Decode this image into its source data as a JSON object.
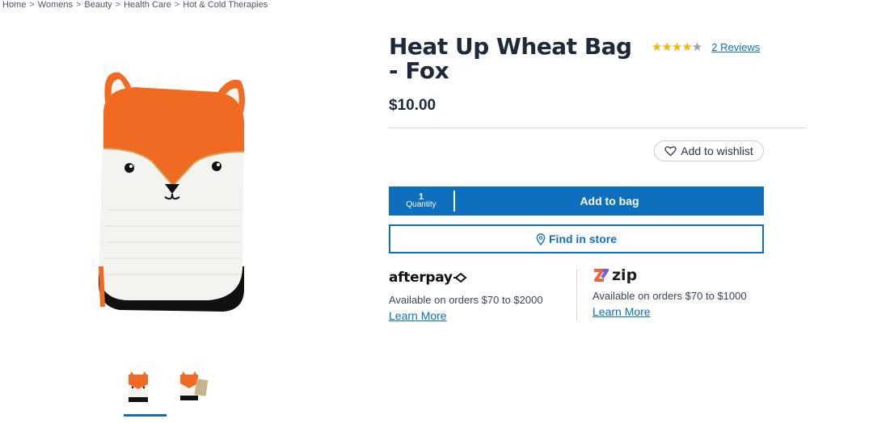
{
  "breadcrumb": [
    "Home",
    "Womens",
    "Beauty",
    "Health Care",
    "Hot & Cold Therapies"
  ],
  "breadcrumb_separator": ">",
  "product": {
    "title": "Heat Up Wheat Bag - Fox",
    "rating": {
      "filled": 4,
      "total": 5,
      "stars_filled": "★★★★",
      "stars_empty": "★",
      "reviews_label": "2 Reviews"
    },
    "price": "$10.00"
  },
  "actions": {
    "wishlist_label": "Add to wishlist",
    "quantity_value": "1",
    "quantity_label": "Quantity",
    "add_to_bag_label": "Add to bag",
    "find_in_store_label": "Find in store"
  },
  "payments": {
    "afterpay": {
      "logo_text": "afterpay",
      "description": "Available on orders $70 to $2000",
      "learn_more": "Learn More"
    },
    "zip": {
      "logo_text": "zip",
      "description": "Available on orders $70 to $1000",
      "learn_more": "Learn More"
    }
  },
  "gallery": {
    "image_count": 2,
    "selected_index": 0
  },
  "colors": {
    "accent": "#0e6fbe",
    "star": "#f5b800",
    "fox_orange": "#f06a22",
    "text_dark": "#1e2a3a"
  },
  "icons": [
    "heart-icon",
    "map-pin-icon",
    "afterpay-arrows-icon",
    "zip-logo-icon"
  ]
}
